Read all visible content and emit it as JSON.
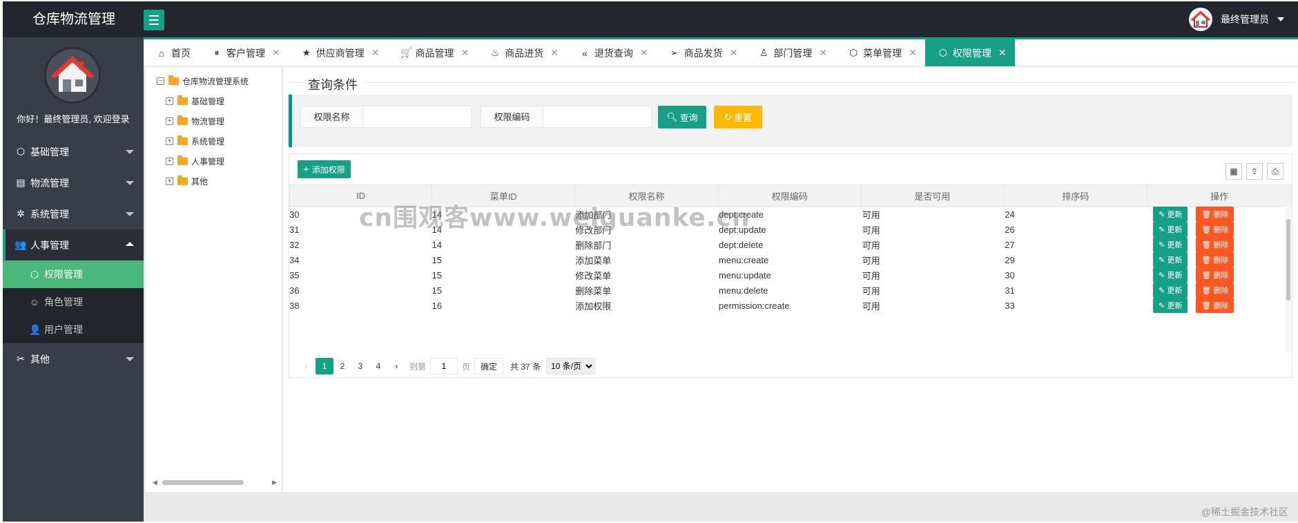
{
  "app": {
    "title": "仓库物流管理",
    "user_name": "最终管理员"
  },
  "sidebar": {
    "welcome": "你好！最终管理员, 欢迎登录",
    "items": [
      {
        "label": "基础管理",
        "icon": "cube-icon"
      },
      {
        "label": "物流管理",
        "icon": "clipboard-icon"
      },
      {
        "label": "系统管理",
        "icon": "gear-icon"
      },
      {
        "label": "人事管理",
        "icon": "users-icon",
        "expanded": true
      },
      {
        "label": "其他",
        "icon": "tools-icon"
      }
    ],
    "sub_items": [
      {
        "label": "权限管理",
        "icon": "cube-icon",
        "active": true
      },
      {
        "label": "角色管理",
        "icon": "smile-icon"
      },
      {
        "label": "用户管理",
        "icon": "user-icon"
      }
    ]
  },
  "tabs": [
    {
      "label": "首页",
      "icon": "home-icon",
      "closable": false
    },
    {
      "label": "客户管理",
      "icon": "pause-circle-icon"
    },
    {
      "label": "供应商管理",
      "icon": "star-icon"
    },
    {
      "label": "商品管理",
      "icon": "cart-icon"
    },
    {
      "label": "商品进货",
      "icon": "fire-icon"
    },
    {
      "label": "退货查询",
      "icon": "double-left-icon"
    },
    {
      "label": "商品发货",
      "icon": "paper-plane-icon"
    },
    {
      "label": "部门管理",
      "icon": "user-icon"
    },
    {
      "label": "菜单管理",
      "icon": "cube-icon"
    },
    {
      "label": "权限管理",
      "icon": "cube-icon",
      "active": true
    }
  ],
  "tab_close_glyph": "✕",
  "tree": {
    "root": {
      "label": "仓库物流管理系统",
      "toggle": "−"
    },
    "children": [
      {
        "label": "基础管理",
        "toggle": "+"
      },
      {
        "label": "物流管理",
        "toggle": "+"
      },
      {
        "label": "系统管理",
        "toggle": "+"
      },
      {
        "label": "人事管理",
        "toggle": "+"
      },
      {
        "label": "其他",
        "toggle": "+"
      }
    ]
  },
  "query": {
    "legend": "查询条件",
    "name_label": "权限名称",
    "name_value": "",
    "code_label": "权限编码",
    "code_value": "",
    "search_button": "查询",
    "reset_button": "重置"
  },
  "table": {
    "add_button": "添加权限",
    "columns": [
      "ID",
      "菜单ID",
      "权限名称",
      "权限编码",
      "是否可用",
      "排序码",
      "操作"
    ],
    "rows": [
      {
        "id": "30",
        "menu_id": "14",
        "name": "添加部门",
        "code": "dept:create",
        "available": "可用",
        "order": "24"
      },
      {
        "id": "31",
        "menu_id": "14",
        "name": "修改部门",
        "code": "dept:update",
        "available": "可用",
        "order": "26"
      },
      {
        "id": "32",
        "menu_id": "14",
        "name": "删除部门",
        "code": "dept:delete",
        "available": "可用",
        "order": "27"
      },
      {
        "id": "34",
        "menu_id": "15",
        "name": "添加菜单",
        "code": "menu:create",
        "available": "可用",
        "order": "29"
      },
      {
        "id": "35",
        "menu_id": "15",
        "name": "修改菜单",
        "code": "menu:update",
        "available": "可用",
        "order": "30"
      },
      {
        "id": "36",
        "menu_id": "15",
        "name": "删除菜单",
        "code": "menu:delete",
        "available": "可用",
        "order": "31"
      },
      {
        "id": "38",
        "menu_id": "16",
        "name": "添加权限",
        "code": "permission:create",
        "available": "可用",
        "order": "33"
      }
    ],
    "update_button": "更新",
    "delete_button": "删除"
  },
  "pager": {
    "pages": [
      "1",
      "2",
      "3",
      "4"
    ],
    "current": "1",
    "goto_label": "到第",
    "goto_value": "1",
    "page_unit": "页",
    "confirm": "确定",
    "total": "共 37 条",
    "page_size": "10 条/页"
  },
  "watermark": "cn围观客www.weiguanke.cn",
  "credit": "@稀土掘金技术社区",
  "colors": {
    "accent": "#16a085",
    "header": "#23262e",
    "sidebar": "#393d49",
    "active_sub": "#4bb87b",
    "warn": "#ffb800",
    "danger": "#ff5722",
    "available": "#1e3ea8"
  }
}
